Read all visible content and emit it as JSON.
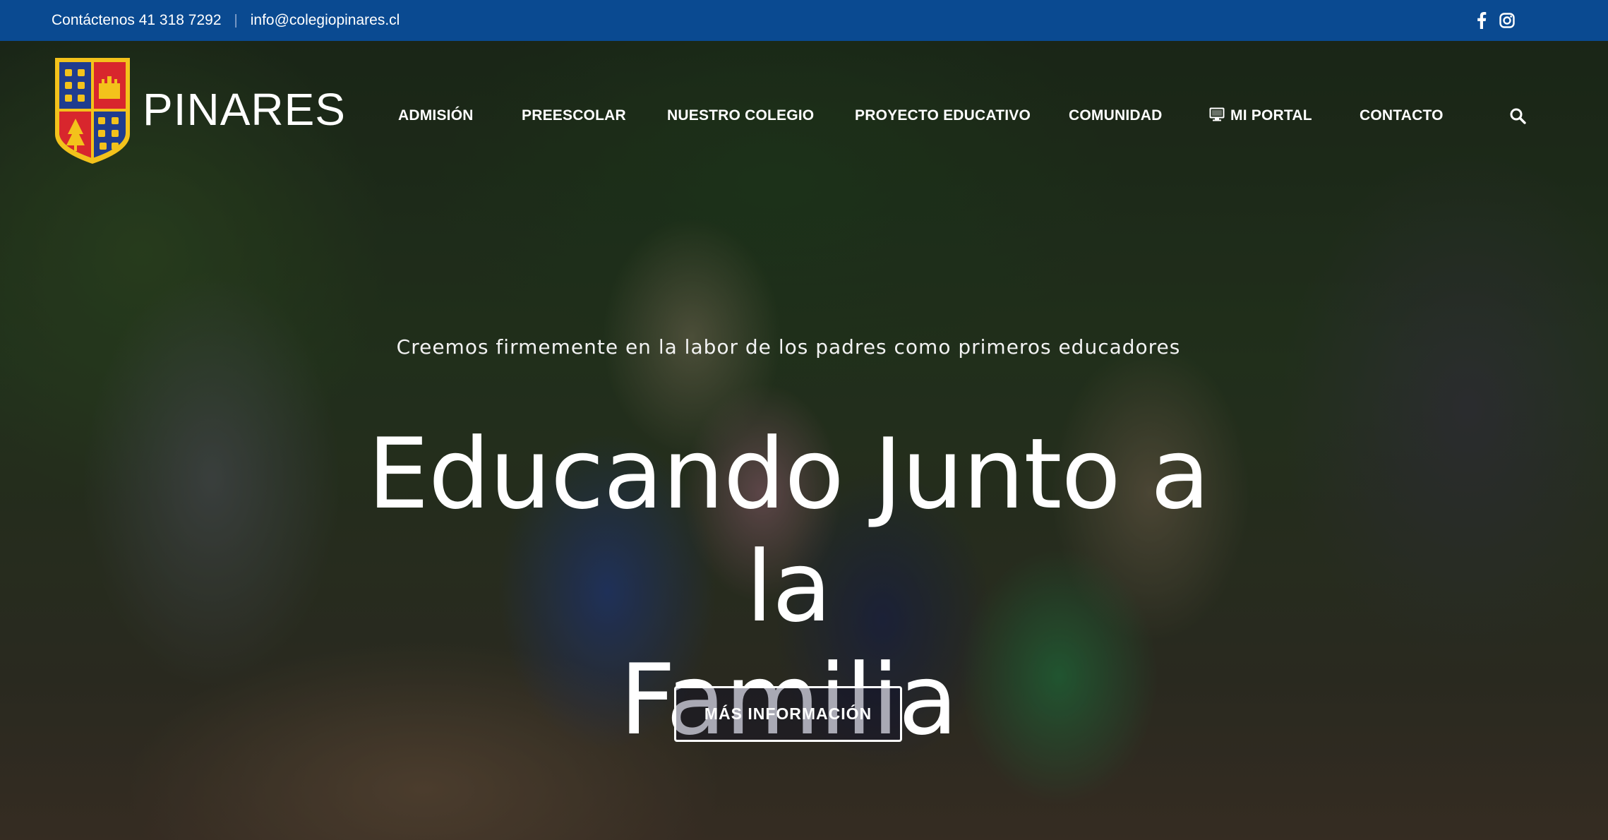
{
  "topbar": {
    "phone_text": "Contáctenos 41 318 7292",
    "separator": "|",
    "email": "info@colegiopinares.cl",
    "social_icons": [
      "facebook-icon",
      "instagram-icon"
    ]
  },
  "header": {
    "brand": "PINARES",
    "nav": [
      {
        "label": "ADMISIÓN"
      },
      {
        "label": "PREESCOLAR"
      },
      {
        "label": "NUESTRO COLEGIO"
      },
      {
        "label": "PROYECTO EDUCATIVO"
      },
      {
        "label": "COMUNIDAD"
      },
      {
        "label": "MI PORTAL",
        "icon": "monitor-icon"
      },
      {
        "label": "CONTACTO"
      }
    ],
    "search_icon": "search-icon"
  },
  "hero": {
    "tagline": "Creemos firmemente en la labor de los padres como primeros educadores",
    "headline_line1": "Educando Junto a la",
    "headline_line2": "Familia",
    "cta_label": "MÁS INFORMACIÓN"
  },
  "colors": {
    "topbar_bg": "#0a4a91",
    "crest_blue": "#1f3c8f",
    "crest_red": "#d8262d",
    "crest_gold": "#f3c21b",
    "text_white": "#ffffff"
  }
}
